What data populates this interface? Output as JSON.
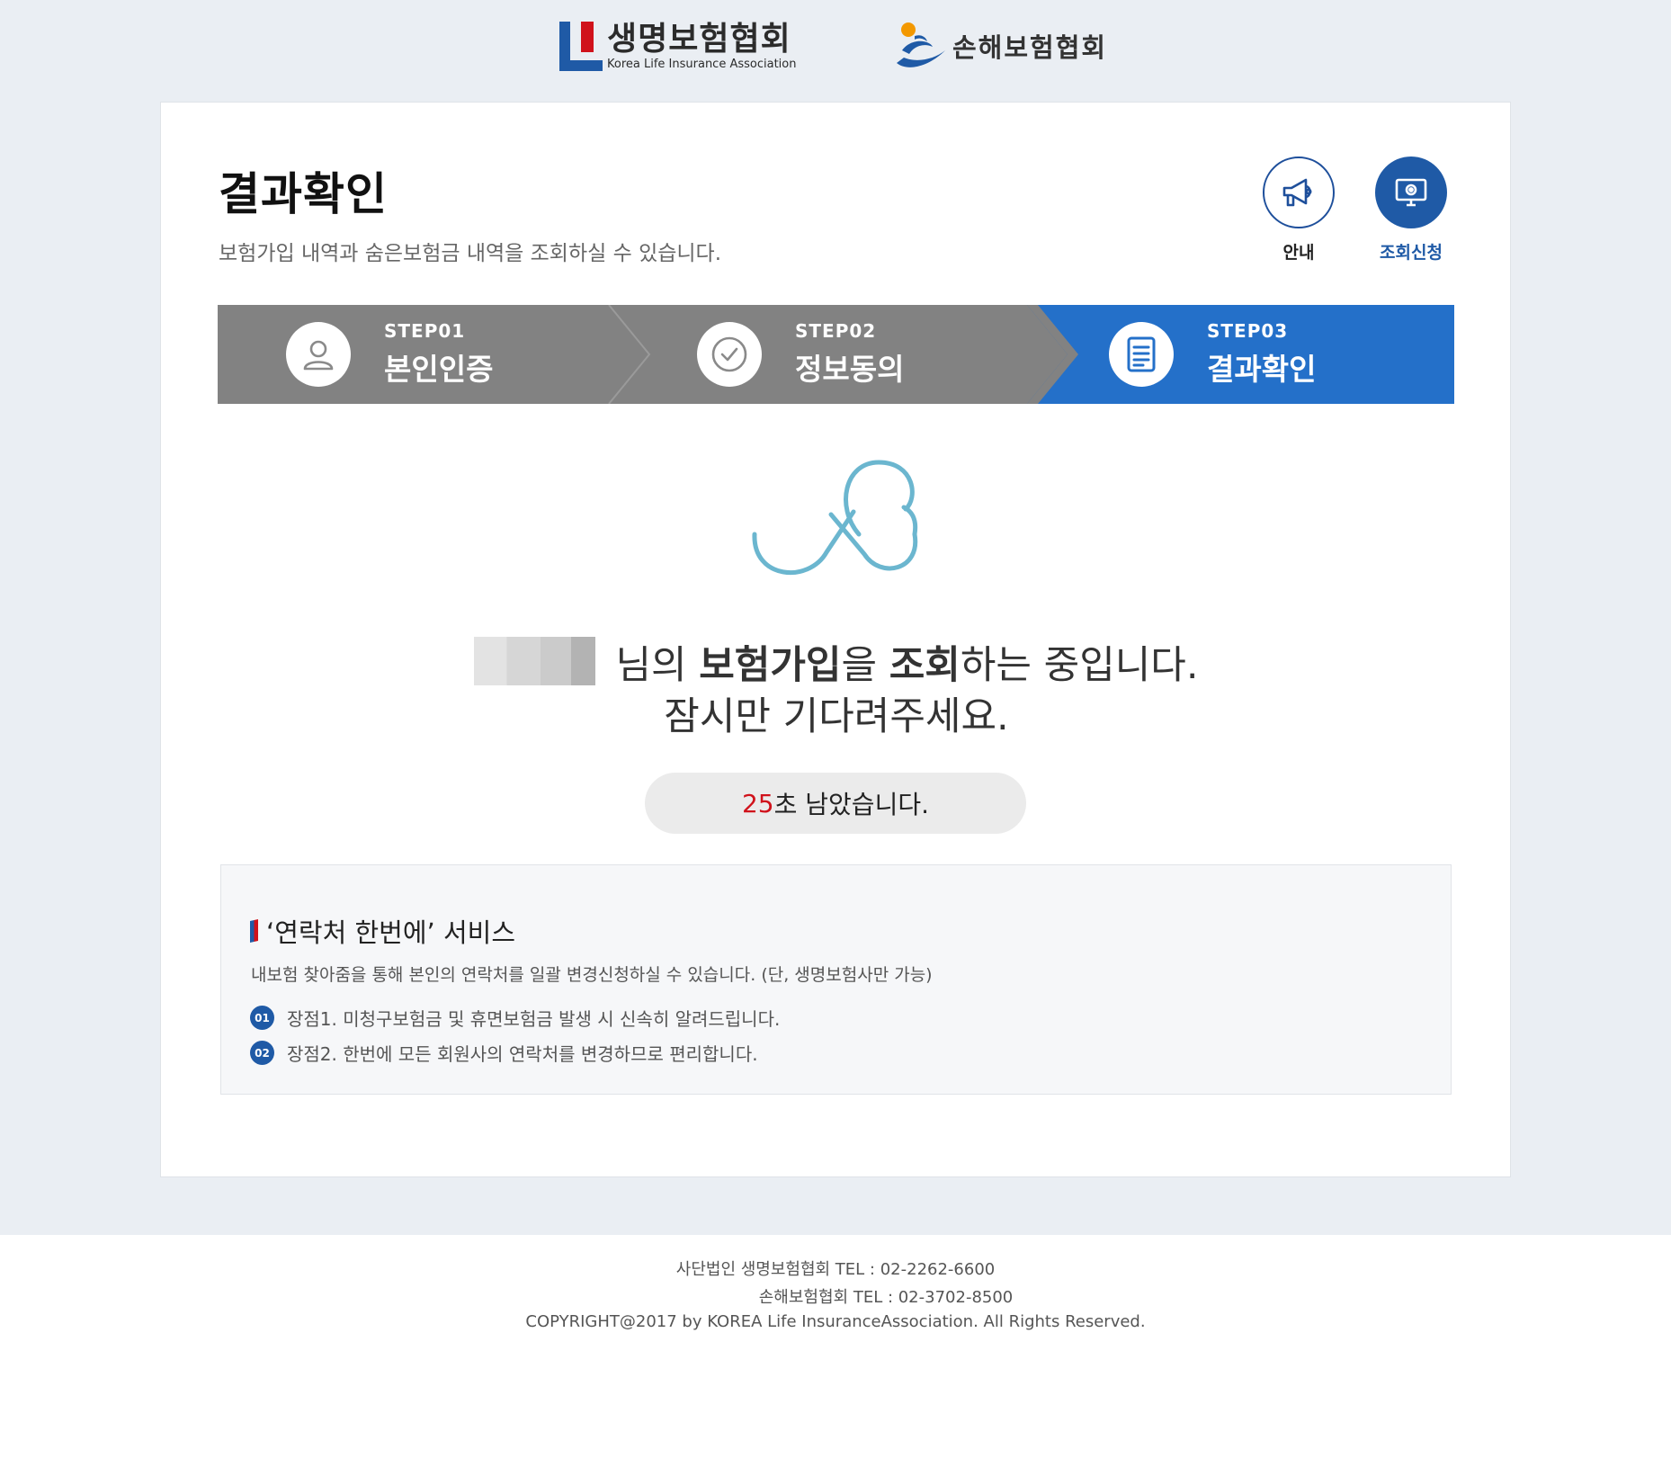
{
  "header": {
    "klia_logo_ko": "생명보험협회",
    "klia_logo_en": "Korea Life Insurance Association",
    "gia_logo_ko": "손해보험협회"
  },
  "page": {
    "title": "결과확인",
    "subtitle": "보험가입 내역과 숨은보험금 내역을 조회하실 수 있습니다."
  },
  "quick_buttons": [
    {
      "label": "안내",
      "icon": "megaphone-icon"
    },
    {
      "label": "조회신청",
      "icon": "monitor-icon"
    }
  ],
  "steps": [
    {
      "num": "STEP01",
      "name": "본인인증",
      "icon": "person-icon",
      "active": false
    },
    {
      "num": "STEP02",
      "name": "정보동의",
      "icon": "check-circle-icon",
      "active": false
    },
    {
      "num": "STEP03",
      "name": "결과확인",
      "icon": "document-icon",
      "active": true
    }
  ],
  "status": {
    "suffix_1": "님의 ",
    "bold_1": "보험가입",
    "mid_1": "을 ",
    "bold_2": "조회",
    "tail_1": "하는 중입니다.",
    "line_2": "잠시만 기다려주세요.",
    "countdown_seconds": "25",
    "countdown_text": "초 남았습니다."
  },
  "info": {
    "title": "‘연락처 한번에’ 서비스",
    "desc": "내보험 찾아줌을 통해 본인의 연락처를 일괄 변경신청하실 수 있습니다. (단, 생명보험사만 가능)",
    "items": [
      {
        "badge": "01",
        "text": "장점1. 미청구보험금 및 휴면보험금 발생 시 신속히 알려드립니다."
      },
      {
        "badge": "02",
        "text": "장점2. 한번에 모든 회원사의 연락처를 변경하므로 편리합니다."
      }
    ]
  },
  "footer": {
    "line1": "사단법인 생명보험협회 TEL : 02-2262-6600",
    "line2": "손해보험협회 TEL : 02-3702-8500",
    "line3": "COPYRIGHT@2017 by KOREA Life InsuranceAssociation. All Rights Reserved."
  },
  "colors": {
    "page_bg": "#eaeef3",
    "step_inactive": "#828282",
    "step_active": "#2470c9",
    "brand_blue": "#1f5aa6",
    "countdown_red": "#d0121b",
    "loader": "#6bb6cf"
  }
}
